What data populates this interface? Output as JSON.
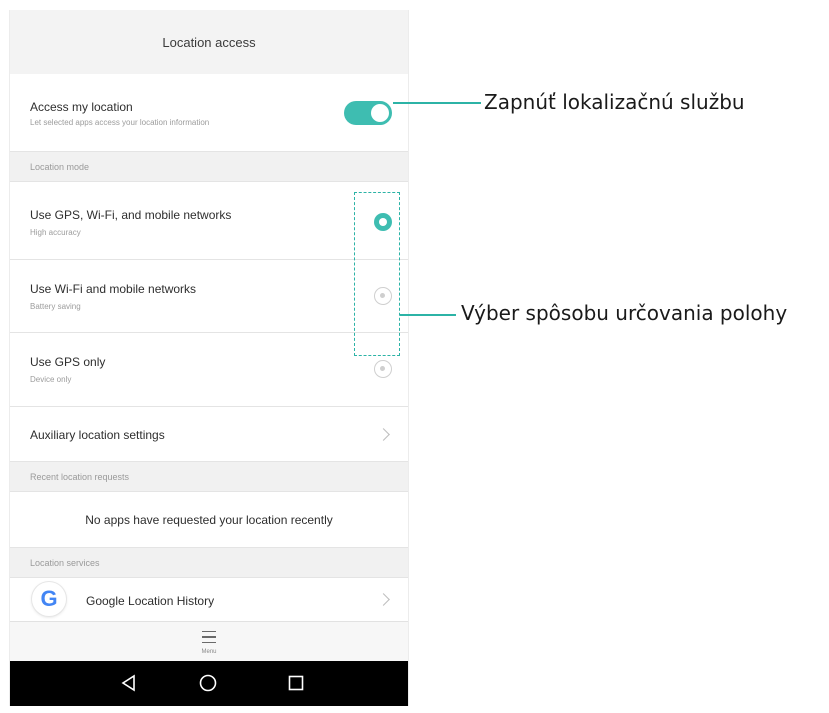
{
  "header": {
    "title": "Location access"
  },
  "access": {
    "title": "Access my location",
    "subtitle": "Let selected apps access your location information",
    "enabled": true
  },
  "sections": {
    "location_mode": "Location mode",
    "recent_requests": "Recent location requests",
    "location_services": "Location services"
  },
  "modes": [
    {
      "title": "Use GPS, Wi-Fi, and mobile networks",
      "subtitle": "High accuracy",
      "selected": true
    },
    {
      "title": "Use Wi-Fi and mobile networks",
      "subtitle": "Battery saving",
      "selected": false
    },
    {
      "title": "Use GPS only",
      "subtitle": "Device only",
      "selected": false
    }
  ],
  "auxiliary": {
    "title": "Auxiliary location settings"
  },
  "recent": {
    "empty_text": "No apps have requested your location recently"
  },
  "services": [
    {
      "title": "Google Location History",
      "icon": "google-g-icon",
      "icon_glyph": "G"
    }
  ],
  "menu": {
    "label": "Menu"
  },
  "callouts": {
    "toggle": "Zapnúť lokalizačnú službu",
    "modes": "Výber spôsobu určovania polohy"
  },
  "colors": {
    "accent": "#3ebdb1",
    "callout_line": "#2cb3a6"
  }
}
